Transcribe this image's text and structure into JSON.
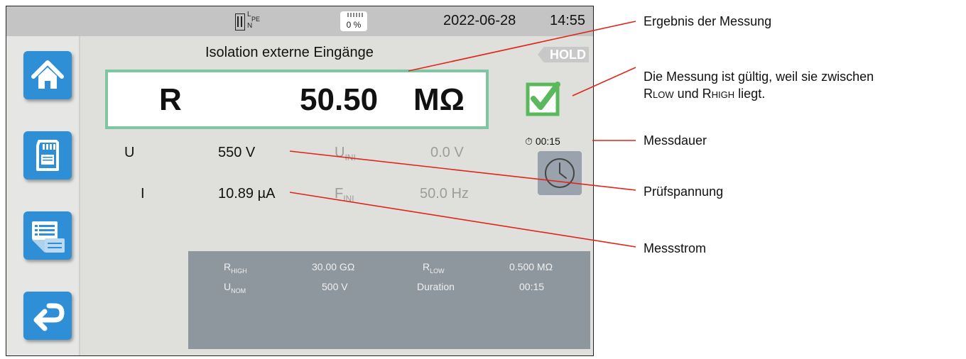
{
  "status": {
    "plug_l": "L",
    "plug_n": "N",
    "plug_pe": "PE",
    "memory_percent": "0 %",
    "date": "2022-06-28",
    "time": "14:55"
  },
  "sidebar": {
    "items": [
      {
        "name": "home",
        "icon": "home-icon"
      },
      {
        "name": "memory",
        "icon": "sd-card-icon"
      },
      {
        "name": "report",
        "icon": "report-icon"
      },
      {
        "name": "back",
        "icon": "back-arrow-icon"
      }
    ]
  },
  "measurement": {
    "title": "Isolation externe Eingänge",
    "hold_label": "HOLD",
    "result_symbol": "R",
    "result_value": "50.50",
    "result_unit": "MΩ",
    "valid": true,
    "duration": "00:15",
    "rows": [
      {
        "label": "U",
        "value": "550 V",
        "ini_label": "U",
        "ini_sub": "INI",
        "ini_value": "0.0 V"
      },
      {
        "label": "I",
        "value": "10.89 µA",
        "ini_label": "F",
        "ini_sub": "INI",
        "ini_value": "50.0 Hz"
      }
    ]
  },
  "settings": {
    "rhigh_label": "R",
    "rhigh_sub": "HIGH",
    "rhigh_value": "30.00 GΩ",
    "rlow_label": "R",
    "rlow_sub": "LOW",
    "rlow_value": "0.500 MΩ",
    "unom_label": "U",
    "unom_sub": "NOM",
    "unom_value": "500 V",
    "duration_label": "Duration",
    "duration_value": "00:15"
  },
  "annotations": {
    "result": "Ergebnis der Messung",
    "valid_line1": "Die Messung ist gültig, weil sie zwischen",
    "valid_r1": "R",
    "valid_low": "low",
    "valid_und": " und ",
    "valid_r2": "R",
    "valid_high": "high",
    "valid_end": " liegt.",
    "duration": "Messdauer",
    "voltage": "Prüfspannung",
    "current": "Messstrom"
  },
  "colors": {
    "nav_blue": "#2e8ed6",
    "result_border": "#7fc5a1",
    "valid_green": "#5cb85c",
    "annotation_line": "#e0251b"
  }
}
